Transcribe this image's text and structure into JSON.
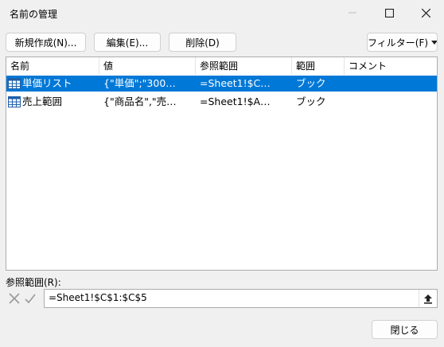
{
  "window": {
    "title": "名前の管理"
  },
  "toolbar": {
    "new_label": "新規作成(N)...",
    "edit_label": "編集(E)...",
    "delete_label": "削除(D)",
    "filter_label": "フィルター(F)"
  },
  "columns": [
    "名前",
    "値",
    "参照範囲",
    "範囲",
    "コメント"
  ],
  "rows": [
    {
      "name": "単価リスト",
      "value": "{\"単価\";\"300…",
      "refers_to": "=Sheet1!$C…",
      "scope": "ブック",
      "comment": "",
      "selected": true
    },
    {
      "name": "売上範囲",
      "value": "{\"商品名\",\"売…",
      "refers_to": "=Sheet1!$A…",
      "scope": "ブック",
      "comment": "",
      "selected": false
    }
  ],
  "refers_to_label": "参照範囲(R):",
  "refers_to_value": "=Sheet1!$C$1:$C$5",
  "close_label": "閉じる",
  "colors": {
    "selection": "#0078d7",
    "background": "#f0f0f0"
  },
  "icons": [
    "minimize-icon",
    "maximize-icon",
    "close-icon",
    "chevron-down-icon",
    "table-icon",
    "cancel-x-icon",
    "check-icon",
    "collapse-upload-icon"
  ]
}
